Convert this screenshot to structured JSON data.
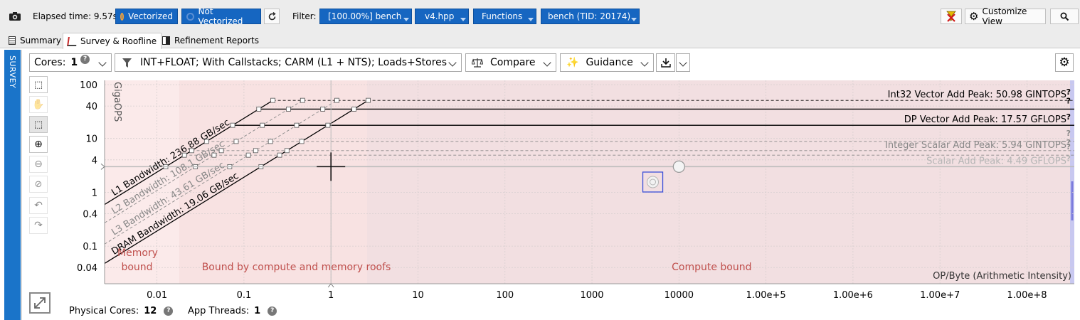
{
  "toolbar": {
    "elapsed": "Elapsed time: 9.57s",
    "vectorized": "Vectorized",
    "not_vectorized": "Not Vectorized",
    "filter_label": "Filter:",
    "filter_bench": "[100.00%] bench",
    "filter_file": "v4.hpp",
    "filter_functions": "Functions",
    "filter_thread": "bench (TID: 20174)",
    "customize": "Customize View"
  },
  "tabs": [
    "Summary",
    "Survey & Roofline",
    "Refinement Reports"
  ],
  "side_tab": "SURVEY",
  "controls": {
    "cores_label": "Cores:",
    "cores_value": "1",
    "filter_text": "INT+FLOAT; With Callstacks; CARM (L1 + NTS); Loads+Stores",
    "compare": "Compare",
    "guidance": "Guidance"
  },
  "chart_data": {
    "type": "scatter",
    "title": "",
    "xlabel": "OP/Byte",
    "xlabel_sub": "(Arithmetic Intensity)",
    "ylabel": "GigaOPS",
    "xscale": "log",
    "yscale": "log",
    "xlim": [
      0.0025,
      350000000
    ],
    "ylim": [
      0.02,
      120
    ],
    "x_ticks": [
      {
        "v": 0.01,
        "label": "0.01"
      },
      {
        "v": 0.1,
        "label": "0.1"
      },
      {
        "v": 1,
        "label": "1"
      },
      {
        "v": 10,
        "label": "10"
      },
      {
        "v": 100,
        "label": "100"
      },
      {
        "v": 1000,
        "label": "1000"
      },
      {
        "v": 10000,
        "label": "10000"
      },
      {
        "v": 100000,
        "label": "1.00e+5"
      },
      {
        "v": 1000000,
        "label": "1.00e+6"
      },
      {
        "v": 10000000,
        "label": "1.00e+7"
      },
      {
        "v": 100000000,
        "label": "1.00e+8"
      }
    ],
    "y_ticks": [
      {
        "v": 0.04,
        "label": "0.04"
      },
      {
        "v": 0.1,
        "label": "0.1"
      },
      {
        "v": 0.4,
        "label": "0.4"
      },
      {
        "v": 1,
        "label": "1"
      },
      {
        "v": 4,
        "label": "4"
      },
      {
        "v": 10,
        "label": "10"
      },
      {
        "v": 40,
        "label": "40"
      },
      {
        "v": 100,
        "label": "100"
      }
    ],
    "compute_roofs": [
      {
        "label": "Int32 Vector Add Peak: 50.98 GINTOPS",
        "value": 50.98,
        "dashed": true,
        "color": "#000000"
      },
      {
        "label": "",
        "value": 35.1,
        "dashed": false,
        "color": "#000000"
      },
      {
        "label": "DP Vector Add Peak: 17.57 GFLOPS",
        "value": 17.57,
        "dashed": false,
        "color": "#000000"
      },
      {
        "label": "",
        "value": 8.8,
        "dashed": true,
        "color": "#888888"
      },
      {
        "label": "Integer Scalar Add Peak: 5.94 GINTOPS",
        "value": 5.94,
        "dashed": true,
        "color": "#888888"
      },
      {
        "label": "",
        "value": 4.9,
        "dashed": true,
        "color": "#888888"
      },
      {
        "label": "Scalar Add Peak: 4.49 GFLOPS",
        "value": 2.99,
        "dashed": false,
        "color": "#b5b5b5"
      }
    ],
    "memory_roofs": [
      {
        "label": "L1 Bandwidth: 236.88 GB/sec",
        "bandwidth": 236.88,
        "color": "#000000",
        "dashed": false
      },
      {
        "label": "L2 Bandwidth: 108.1 GB/sec",
        "bandwidth": 108.1,
        "color": "#888888",
        "dashed": true
      },
      {
        "label": "L3 Bandwidth: 43.61 GB/sec",
        "bandwidth": 43.61,
        "color": "#888888",
        "dashed": true
      },
      {
        "label": "DRAM Bandwidth: 19.06 GB/sec",
        "bandwidth": 19.06,
        "color": "#000000",
        "dashed": false
      }
    ],
    "regions": [
      {
        "label": "Memory bound",
        "x": 0.006
      },
      {
        "label": "Bound by compute and memory roofs",
        "x": 0.4
      },
      {
        "label": "Compute bound",
        "x": 10000
      }
    ],
    "points": [
      {
        "x": 5000,
        "y": 1.55,
        "selected": true
      },
      {
        "x": 10000,
        "y": 2.99,
        "selected": false
      }
    ],
    "crosshair": {
      "x": 1,
      "y": 2.99
    }
  },
  "bottom": {
    "physical_cores_label": "Physical Cores:",
    "physical_cores_value": "12",
    "app_threads_label": "App Threads:",
    "app_threads_value": "1"
  },
  "colors": {
    "accent": "#1666c1",
    "side_tab": "#1a74c9",
    "region_text": "#c0504d"
  }
}
